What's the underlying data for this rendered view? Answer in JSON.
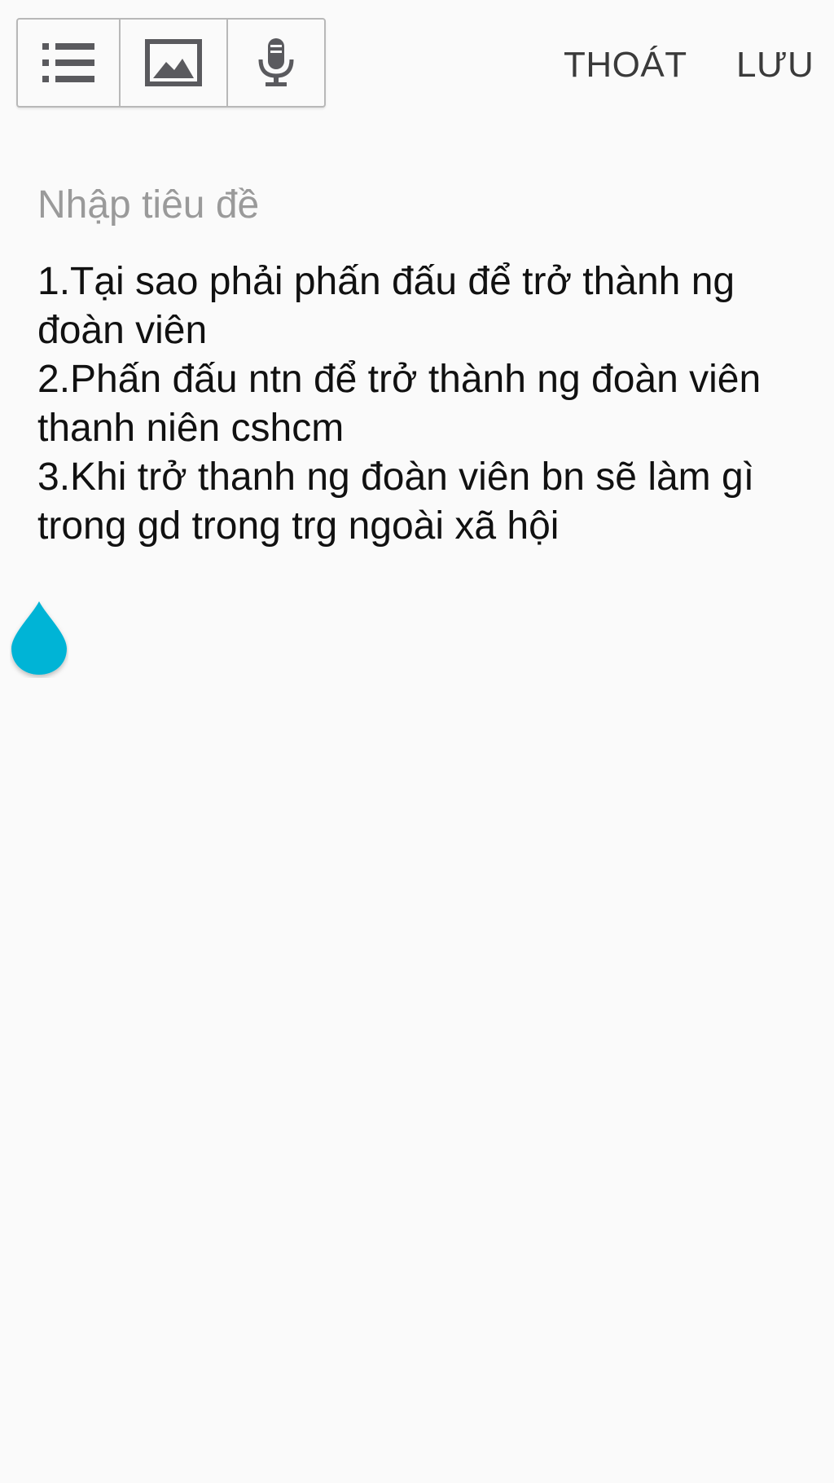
{
  "toolbar": {
    "tools": [
      {
        "icon": "checklist-icon"
      },
      {
        "icon": "image-icon"
      },
      {
        "icon": "microphone-icon"
      }
    ],
    "exit_label": "THOÁT",
    "save_label": "LƯU"
  },
  "editor": {
    "title_placeholder": "Nhập tiêu đề",
    "title_value": "",
    "body_lines": [
      "1.Tại sao phải phấn đấu để trở thành ng",
      "đoàn viên",
      "2.Phấn đấu ntn để trở thành ng đoàn viên",
      "thanh niên cshcm",
      "3.Khi trở thanh ng đoàn viên bn sẽ làm gì",
      "trong gd trong trg ngoài xã hội"
    ]
  },
  "colors": {
    "background": "#fafafa",
    "icon": "#5a5a5e",
    "cursor_handle": "#00b4d6"
  }
}
